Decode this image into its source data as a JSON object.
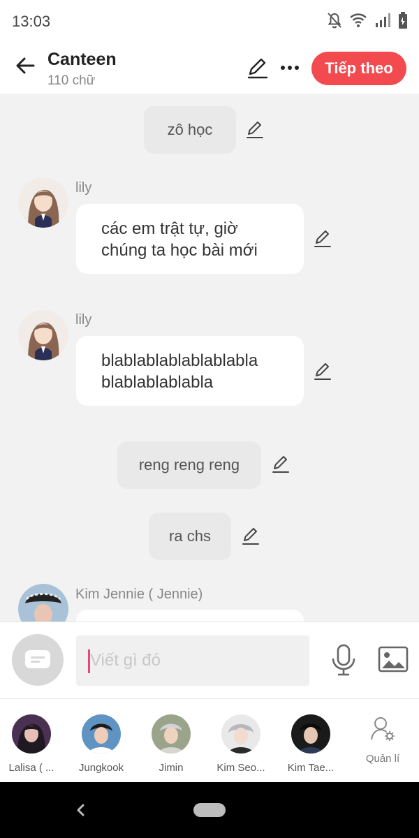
{
  "status_bar": {
    "time": "13:03"
  },
  "header": {
    "title": "Canteen",
    "subtitle": "110 chữ",
    "next_label": "Tiếp theo"
  },
  "messages": [
    {
      "kind": "narration",
      "text": "zô học"
    },
    {
      "kind": "dialog",
      "sender": "lily",
      "text": "các em trật tự, giờ chúng ta học bài mới"
    },
    {
      "kind": "dialog",
      "sender": "lily",
      "text": "blablablablablablabla blablablablabla"
    },
    {
      "kind": "narration",
      "text": "reng reng reng"
    },
    {
      "kind": "narration",
      "text": "ra chs"
    },
    {
      "kind": "dialog",
      "sender": "Kim Jennie ( Jennie)",
      "text": ""
    }
  ],
  "composer": {
    "placeholder": "Viết gì đó"
  },
  "characters": [
    {
      "name": "Lalisa ( ..."
    },
    {
      "name": "Jungkook"
    },
    {
      "name": "Jimin"
    },
    {
      "name": "Kim Seo..."
    },
    {
      "name": "Kim Tae..."
    }
  ],
  "manage_label": "Quản lí",
  "colors": {
    "accent": "#f34a4f",
    "caret": "#e8457b"
  }
}
